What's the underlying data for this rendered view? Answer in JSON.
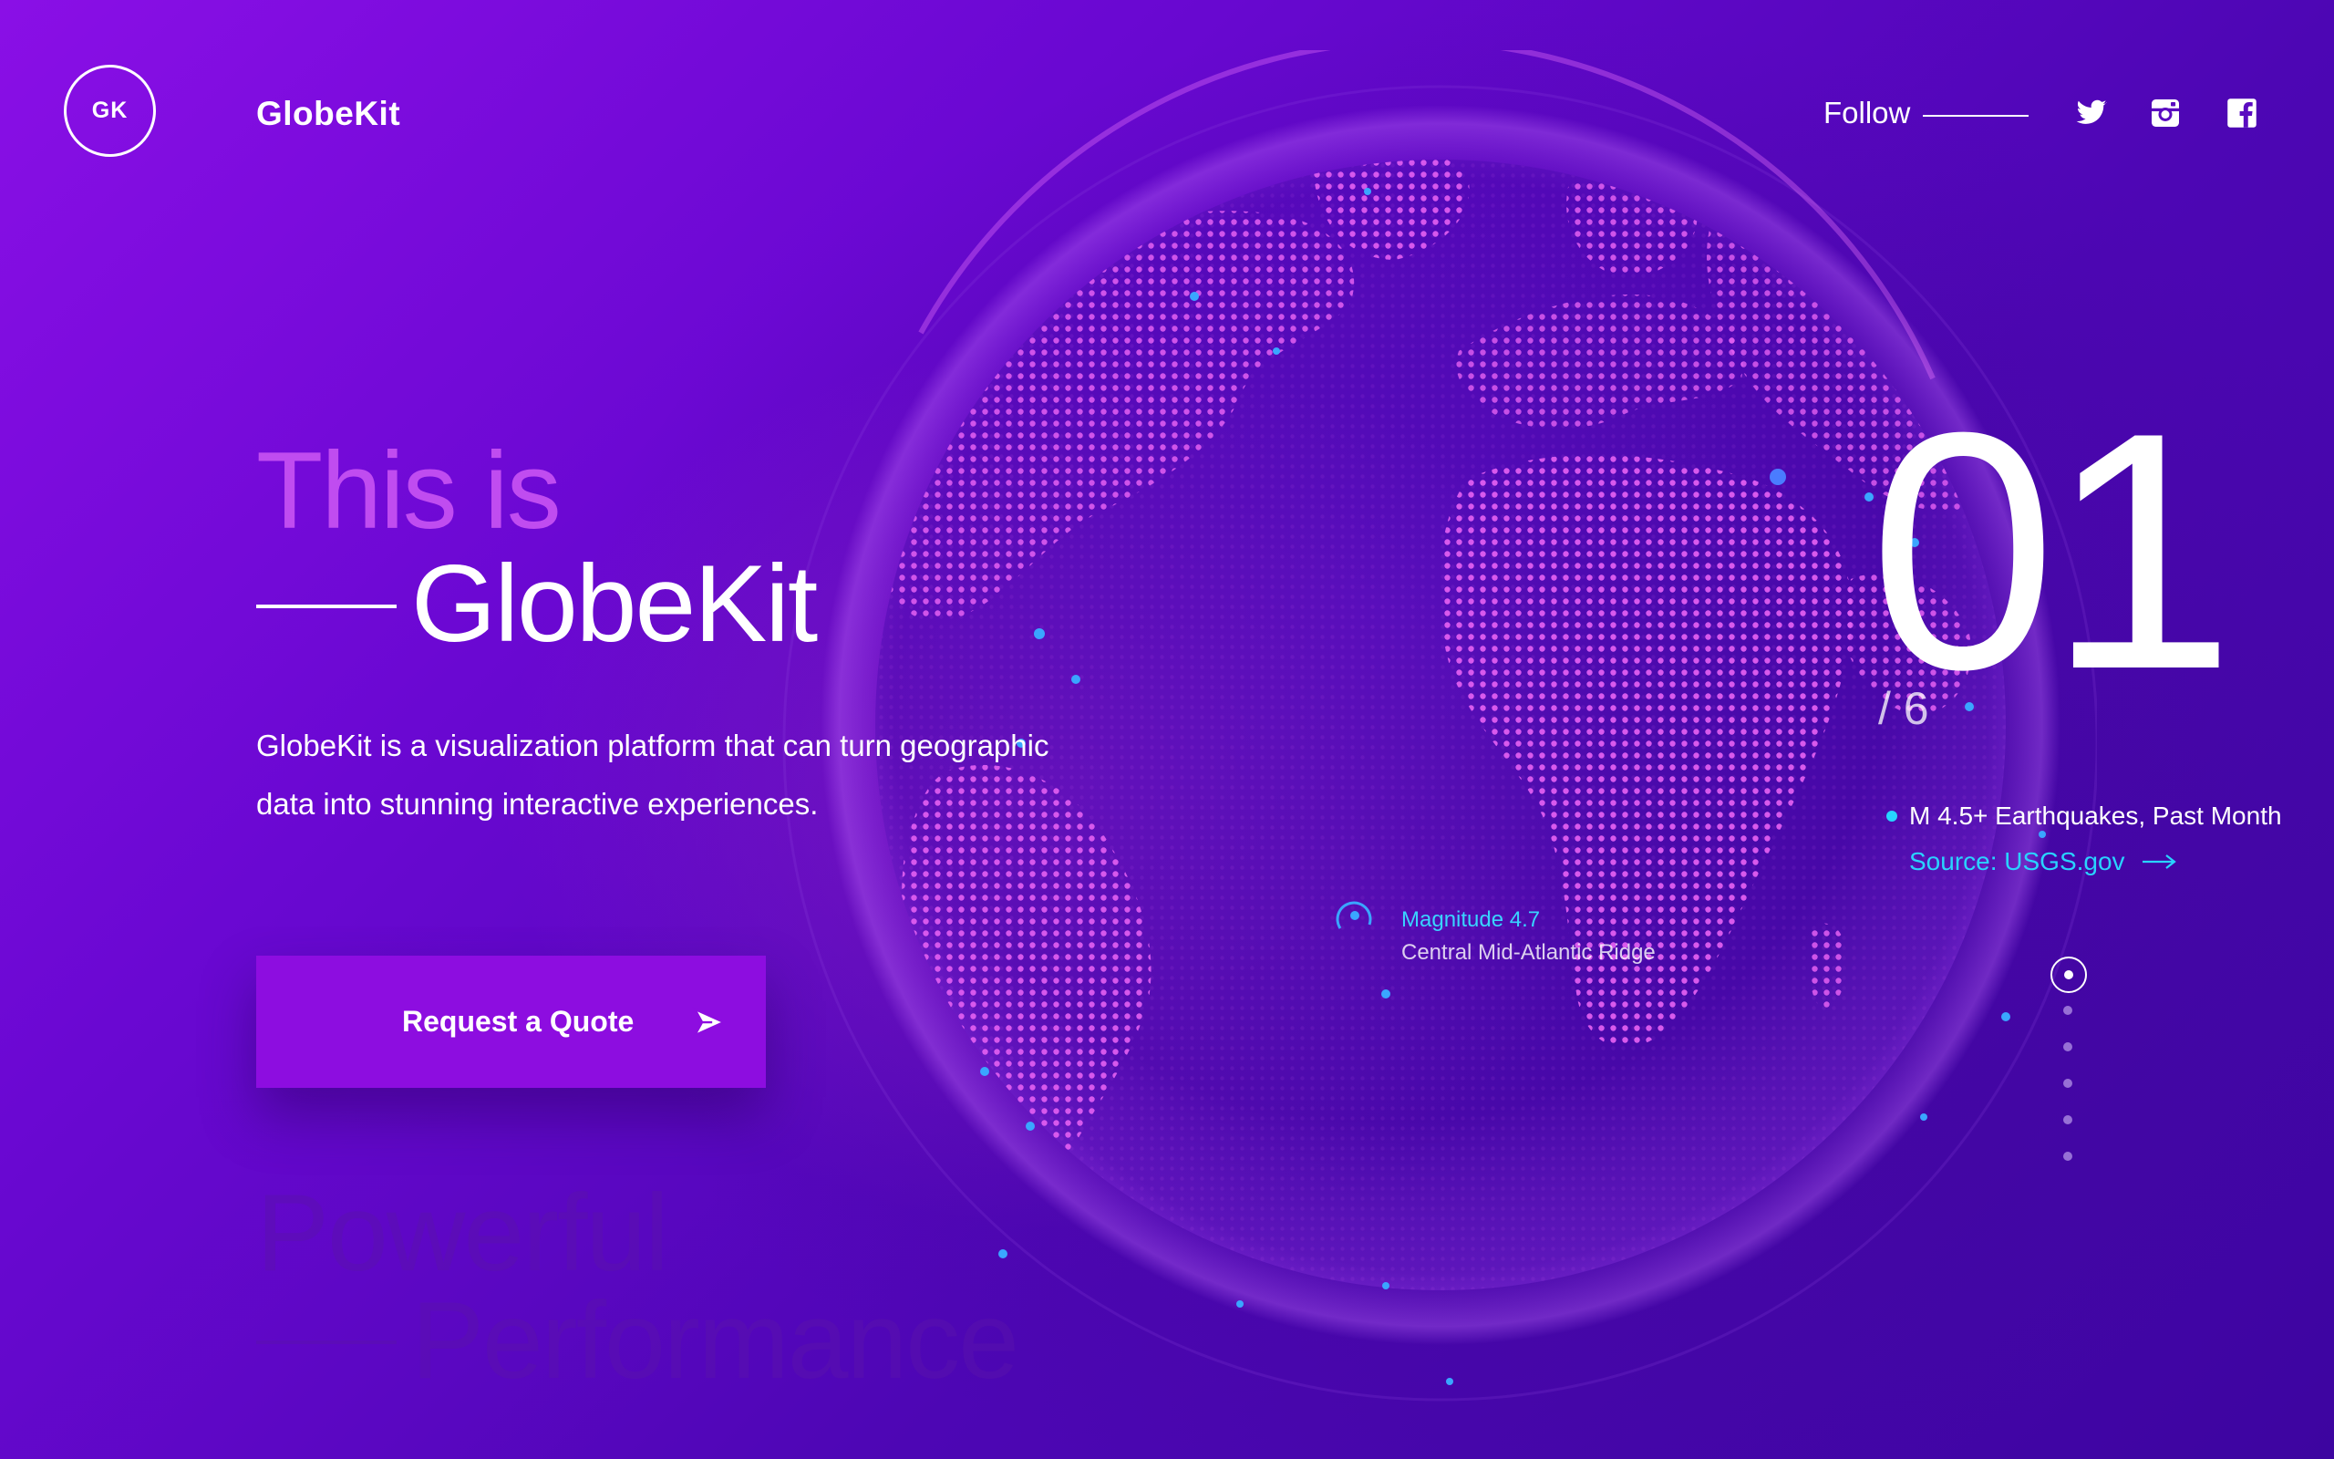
{
  "header": {
    "logo_initials": "GK",
    "brand": "GlobeKit",
    "follow_label": "Follow",
    "social": [
      "twitter-icon",
      "instagram-icon",
      "facebook-icon"
    ]
  },
  "hero": {
    "line1": "This is",
    "line2": "GlobeKit",
    "description_line1": "GlobeKit is a visualization platform that can turn geographic",
    "description_line2": "data into stunning interactive experiences.",
    "cta_label": "Request a Quote",
    "cta_icon": "send-icon",
    "next_line1": "Powerful",
    "next_line2": "Performance"
  },
  "slide": {
    "current": "01",
    "total": "/ 6",
    "count": 6,
    "active_index": 1
  },
  "dataset": {
    "title": "M 4.5+ Earthquakes, Past Month",
    "source": "Source: USGS.gov",
    "source_icon": "arrow-right-icon"
  },
  "annotation": {
    "magnitude": "Magnitude 4.7",
    "location": "Central Mid-Atlantic Ridge"
  },
  "colors": {
    "accent": "#8d0de0",
    "highlight": "#29d3ff",
    "land": "#e25ff0",
    "bg_dark": "#3d05a0"
  }
}
